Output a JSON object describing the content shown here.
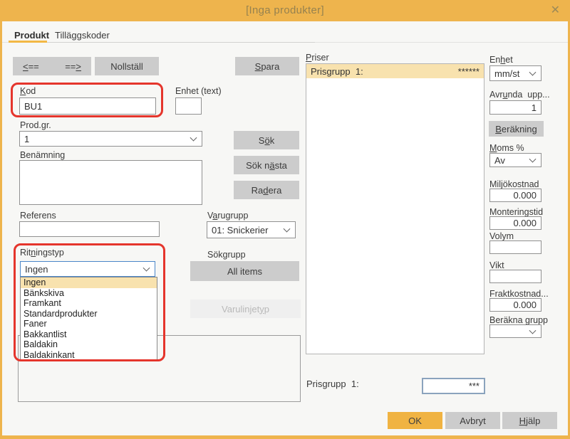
{
  "window": {
    "title": "[Inga produkter]",
    "close_icon": "✕"
  },
  "tabs": {
    "produkt": "Produkt",
    "tillaggskoder": "Tilläggskoder"
  },
  "toolbar": {
    "prev": "<==",
    "next": "==>",
    "reset": "Nollställ",
    "save": "Spara"
  },
  "fields": {
    "kod": {
      "label": "Kod",
      "value": "BU1"
    },
    "enhet_text": {
      "label": "Enhet (text)",
      "value": ""
    },
    "prodgr": {
      "label": "Prod.gr.",
      "value": "1"
    },
    "benamning": {
      "label": "Benämning",
      "value": ""
    },
    "referens": {
      "label": "Referens",
      "value": ""
    },
    "varugrupp": {
      "label": "Varugrupp",
      "value": "01: Snickerier"
    },
    "sokgrupp": {
      "label": "Sökgrupp",
      "button": "All items"
    },
    "ritningstyp": {
      "label": "Ritningstyp",
      "value": "Ingen",
      "options": [
        "Ingen",
        "Bänkskiva",
        "Framkant",
        "Standardprodukter",
        "Faner",
        "Bakkantlist",
        "Baldakin",
        "Baldakinkant"
      ]
    }
  },
  "actions": {
    "sok": "Sök",
    "sok_nasta": "Sök nästa",
    "radera": "Radera",
    "varulinjetyp": "Varulinjetyp"
  },
  "priser": {
    "label": "Priser",
    "row": {
      "name": "Prisgrupp  1:",
      "value": "******"
    }
  },
  "right_panel": {
    "enhet": {
      "label": "Enhet",
      "value": "mm/st"
    },
    "avrunda": {
      "label": "Avrunda  upp...",
      "value": "1"
    },
    "berakning": "Beräkning",
    "moms": {
      "label": "Moms %",
      "value": "Av"
    },
    "miljokostnad": {
      "label": "Miljökostnad",
      "value": "0.000"
    },
    "monteringstid": {
      "label": "Monteringstid",
      "value": "0.000"
    },
    "volym": {
      "label": "Volym",
      "value": ""
    },
    "vikt": {
      "label": "Vikt",
      "value": ""
    },
    "fraktkostnad": {
      "label": "Fraktkostnad...",
      "value": "0.000"
    },
    "berakna_grupp": {
      "label": "Beräkna grupp",
      "value": ""
    }
  },
  "bottom": {
    "prisgrupp_label": "Prisgrupp  1:",
    "prisgrupp_value": "***",
    "ok": "OK",
    "avbryt": "Avbryt",
    "hjalp": "Hjälp"
  },
  "colors": {
    "accent": "#eeb44d",
    "ok_button": "#f0b342",
    "highlight": "#f8e2ae",
    "annotation_ring": "#e5352c",
    "focus_border": "#4a86c8"
  }
}
